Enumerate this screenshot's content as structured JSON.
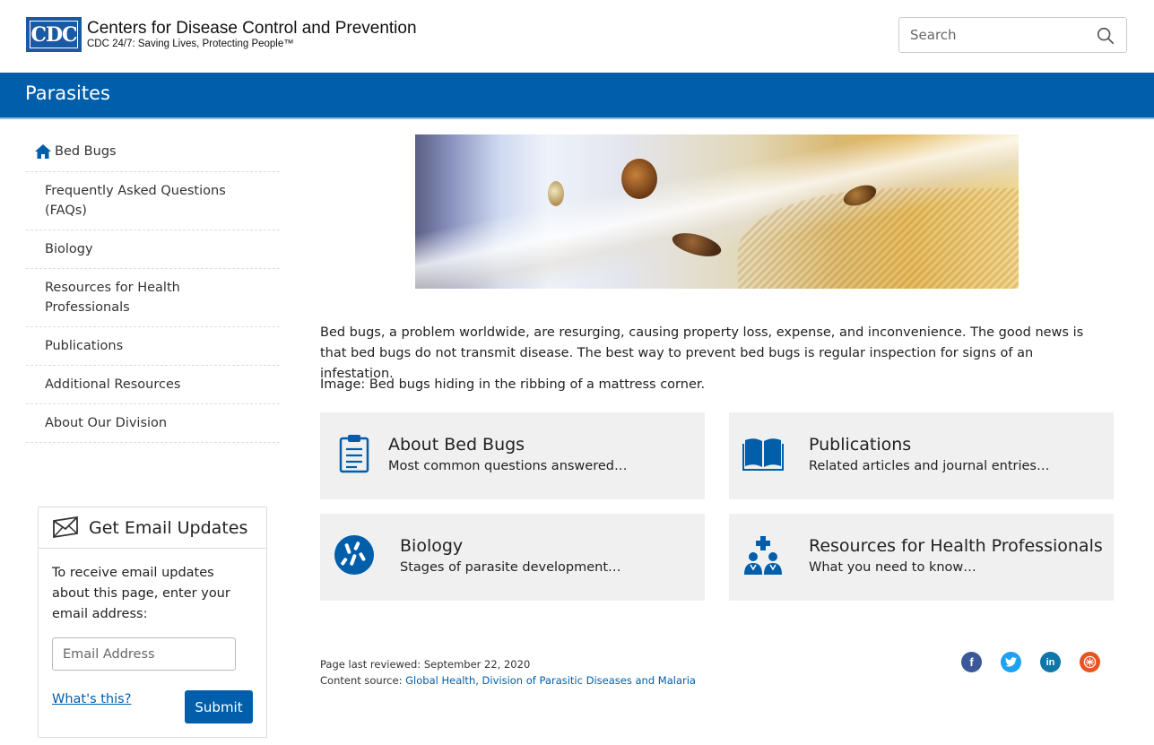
{
  "header": {
    "logo_abbr": "CDC",
    "logo_title": "Centers for Disease Control and Prevention",
    "logo_tagline": "CDC 24/7: Saving Lives, Protecting People™",
    "search_placeholder": "Search"
  },
  "banner": {
    "title": "Parasites"
  },
  "sidebar": {
    "home_label": "Bed Bugs",
    "items": [
      {
        "label": "Frequently Asked Questions (FAQs)"
      },
      {
        "label": "Biology"
      },
      {
        "label": "Resources for Health Professionals"
      },
      {
        "label": "Publications"
      },
      {
        "label": "Additional Resources"
      },
      {
        "label": "About Our Division"
      }
    ]
  },
  "email": {
    "title": "Get Email Updates",
    "description": "To receive email updates about this page, enter your email address:",
    "input_placeholder": "Email Address",
    "whats_this": "What's this?",
    "submit_label": "Submit"
  },
  "main": {
    "intro": "Bed bugs, a problem worldwide, are resurging, causing property loss, expense, and inconvenience. The good news is that bed bugs do not transmit disease. The best way to prevent bed bugs is regular inspection for signs of an infestation.",
    "caption": "Image: Bed bugs hiding in the ribbing of a mattress corner.",
    "cards": [
      {
        "title": "About Bed Bugs",
        "subtitle": "Most common questions answered…",
        "icon": "clipboard-icon"
      },
      {
        "title": "Publications",
        "subtitle": "Related articles and journal entries…",
        "icon": "book-icon"
      },
      {
        "title": "Biology",
        "subtitle": "Stages of parasite development…",
        "icon": "bacteria-icon"
      },
      {
        "title": "Resources for Health Professionals",
        "subtitle": "What you need to know…",
        "icon": "doctors-icon"
      }
    ]
  },
  "footer": {
    "reviewed": "Page last reviewed: September 22, 2020",
    "source_label": "Content source: ",
    "source_link": "Global Health, Division of Parasitic Diseases and Malaria"
  },
  "colors": {
    "brand_blue": "#005eaa",
    "facebook": "#3b5998",
    "twitter": "#1da1f2",
    "linkedin": "#0e76a8",
    "syndicate": "#e8541f"
  }
}
